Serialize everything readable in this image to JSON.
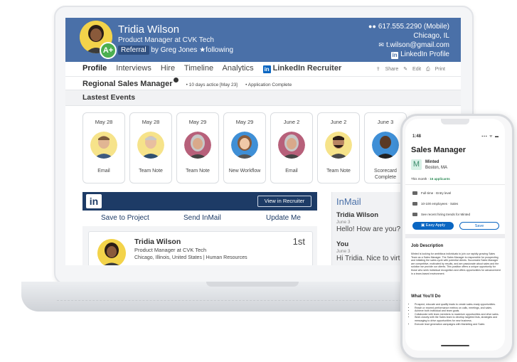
{
  "profile": {
    "name": "Tridia Wilson",
    "title": "Product Manager at CVK Tech",
    "badge": "A+",
    "referral_tag": "Referral",
    "referral_by": "by Greg Jones",
    "following": "★following",
    "phone": "617.555.2290 (Mobile)",
    "location": "Chicago, IL",
    "email": "t.wilson@gmail.com",
    "linkedin": "LinkedIn Profile"
  },
  "nav": {
    "tabs": [
      "Profile",
      "Interviews",
      "Hire",
      "Timeline",
      "Analytics",
      "LinkedIn Recruiter"
    ],
    "actions": [
      "Share",
      "Edit",
      "Print"
    ]
  },
  "job_row": {
    "job": "Regional Sales Manager",
    "meta1": "10 days actice [May 23]",
    "meta2": "Application Complete"
  },
  "events": {
    "header": "Lastest Events",
    "items": [
      {
        "date": "May 28",
        "label": "Email"
      },
      {
        "date": "May 28",
        "label": "Team Note"
      },
      {
        "date": "May 29",
        "label": "Team Note"
      },
      {
        "date": "May 29",
        "label": "New Workflow"
      },
      {
        "date": "June 2",
        "label": "Email"
      },
      {
        "date": "June 2",
        "label": "Team Note"
      },
      {
        "date": "June 3",
        "label": "Scorecard Complete"
      }
    ]
  },
  "linkedin": {
    "logo": "in",
    "view_button": "View in Recruiter",
    "actions": [
      "Save to Project",
      "Send InMail",
      "Update Me"
    ],
    "card": {
      "name": "Tridia Wilson",
      "title": "Product Manager at CVK Tech",
      "location": "Chicago, Illinois, United States | Human Resources",
      "degree": "1st"
    }
  },
  "inmail": {
    "title": "InMail",
    "messages": [
      {
        "from": "Tridia Wilson",
        "date": "June 3",
        "text": "Hello! How are you?"
      },
      {
        "from": "You",
        "date": "June 3",
        "text": "Hi Tridia. Nice to virtu"
      }
    ]
  },
  "phone": {
    "time": "1:48",
    "status": "▪▪▪ ᯤ ▬",
    "job": "Sales Manager",
    "company_logo": "M",
    "company": "Minted",
    "location": "Boston, MA",
    "month_text": "This month · ",
    "applicants": "16 applicants",
    "facts": [
      "Full-time · Entry level",
      "10-100 employees · Sales",
      "See recent hiring trends for Minted"
    ],
    "apply": "Easy Apply",
    "save": "Save",
    "desc_heading": "Job Description",
    "desc": "Minted is looking for ambitious individuals to join our rapidly growing Sales Team as a Sales Manager. The Sales Manager is responsible for prospecting and initiating the sales cycle with potential clients. Successful Sales Manager are competitive, motivated by results, and are passionate about sales and the solution we provide our clients. This position offers a unique opportunity for those who seek individual recognition and offers opportunities for advancement in a team-based environment.",
    "todo_heading": "What You'll Do",
    "todo": [
      "Prospect, educate and qualify leads to create sales-ready opportunities.",
      "Reach or exceed performance metrics on calls, meetings, and sales.",
      "Achieve both individual and team goals.",
      "Collaborate with team members to maximize opportunities and drive sales.",
      "Work closely with the Sales team to develop targeted lists, strategies and messaging to drive opportunities for new business.",
      "Execute lead generation campaigns with Marketing and Sales"
    ]
  },
  "colors": {
    "header_blue": "#4a70a8",
    "linkedin_navy": "#1d3b66",
    "linkedin_blue": "#0a66c2",
    "badge_green": "#4caf50"
  }
}
